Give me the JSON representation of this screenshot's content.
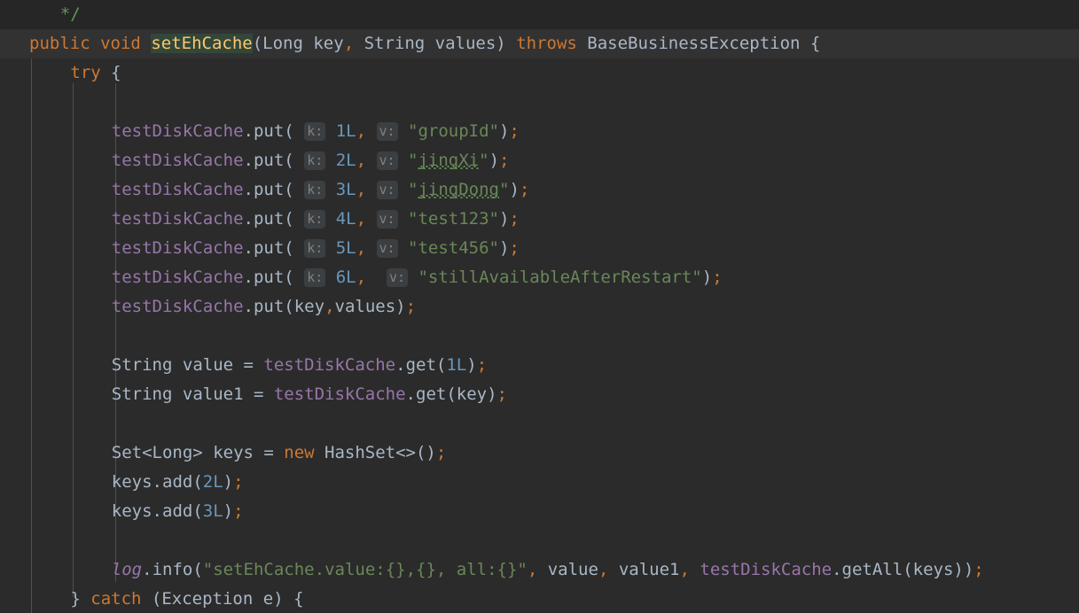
{
  "editor": {
    "language": "java",
    "theme": "darcula",
    "background": "#2b2b2b",
    "caret_line_background": "#323232",
    "colors": {
      "keyword": "#cc7832",
      "string": "#6a8759",
      "number": "#6897bb",
      "field": "#9876aa",
      "plain": "#a9b7c6",
      "comment": "#629755",
      "hint_text": "#808080",
      "hint_background": "#3c3f41",
      "identifier_highlight_background": "#32473a",
      "identifier_highlight_text": "#ffc66d",
      "indent_guide": "#4f5052",
      "typo_squiggle": "#629755"
    }
  },
  "code": {
    "lines": [
      {
        "id": "line-comment-end",
        "background": "dim",
        "indent": 3,
        "tokens": [
          {
            "cls": "cmt",
            "text": "*/"
          }
        ]
      },
      {
        "id": "line-method-signature",
        "background": "caret",
        "indent": 0,
        "tokens": [
          {
            "cls": "kw",
            "text": "public"
          },
          {
            "cls": "pln",
            "text": " "
          },
          {
            "cls": "kw",
            "text": "void"
          },
          {
            "cls": "pln",
            "text": " "
          },
          {
            "cls": "hl-ident",
            "text": "setEhCache"
          },
          {
            "cls": "pln",
            "text": "("
          },
          {
            "cls": "typ",
            "text": "Long"
          },
          {
            "cls": "pln",
            "text": " key"
          },
          {
            "cls": "semi",
            "text": ","
          },
          {
            "cls": "pln",
            "text": " "
          },
          {
            "cls": "typ",
            "text": "String"
          },
          {
            "cls": "pln",
            "text": " values) "
          },
          {
            "cls": "kw",
            "text": "throws"
          },
          {
            "cls": "pln",
            "text": " BaseBusinessException {"
          }
        ]
      },
      {
        "id": "line-try",
        "background": "none",
        "indent": 4,
        "tokens": [
          {
            "cls": "kw",
            "text": "try"
          },
          {
            "cls": "pln",
            "text": " {"
          }
        ]
      },
      {
        "id": "line-blank-1",
        "background": "none",
        "indent": 0,
        "tokens": []
      },
      {
        "id": "line-put-1",
        "background": "none",
        "indent": 8,
        "tokens": [
          {
            "cls": "fld",
            "text": "testDiskCache"
          },
          {
            "cls": "pln",
            "text": "."
          },
          {
            "cls": "mth",
            "text": "put"
          },
          {
            "cls": "pln",
            "text": "( "
          },
          {
            "cls": "hint",
            "text": "k:"
          },
          {
            "cls": "pln",
            "text": " "
          },
          {
            "cls": "num",
            "text": "1L"
          },
          {
            "cls": "semi",
            "text": ","
          },
          {
            "cls": "pln",
            "text": " "
          },
          {
            "cls": "hint",
            "text": "v:"
          },
          {
            "cls": "pln",
            "text": " "
          },
          {
            "cls": "str",
            "text": "\"groupId\""
          },
          {
            "cls": "pln",
            "text": ")"
          },
          {
            "cls": "semi",
            "text": ";"
          }
        ]
      },
      {
        "id": "line-put-2",
        "background": "none",
        "indent": 8,
        "tokens": [
          {
            "cls": "fld",
            "text": "testDiskCache"
          },
          {
            "cls": "pln",
            "text": "."
          },
          {
            "cls": "mth",
            "text": "put"
          },
          {
            "cls": "pln",
            "text": "( "
          },
          {
            "cls": "hint",
            "text": "k:"
          },
          {
            "cls": "pln",
            "text": " "
          },
          {
            "cls": "num",
            "text": "2L"
          },
          {
            "cls": "semi",
            "text": ","
          },
          {
            "cls": "pln",
            "text": " "
          },
          {
            "cls": "hint",
            "text": "v:"
          },
          {
            "cls": "pln",
            "text": " "
          },
          {
            "cls": "str",
            "text": "\""
          },
          {
            "cls": "str typo",
            "text": "jingXi"
          },
          {
            "cls": "str",
            "text": "\""
          },
          {
            "cls": "pln",
            "text": ")"
          },
          {
            "cls": "semi",
            "text": ";"
          }
        ]
      },
      {
        "id": "line-put-3",
        "background": "none",
        "indent": 8,
        "tokens": [
          {
            "cls": "fld",
            "text": "testDiskCache"
          },
          {
            "cls": "pln",
            "text": "."
          },
          {
            "cls": "mth",
            "text": "put"
          },
          {
            "cls": "pln",
            "text": "( "
          },
          {
            "cls": "hint",
            "text": "k:"
          },
          {
            "cls": "pln",
            "text": " "
          },
          {
            "cls": "num",
            "text": "3L"
          },
          {
            "cls": "semi",
            "text": ","
          },
          {
            "cls": "pln",
            "text": " "
          },
          {
            "cls": "hint",
            "text": "v:"
          },
          {
            "cls": "pln",
            "text": " "
          },
          {
            "cls": "str",
            "text": "\""
          },
          {
            "cls": "str typo",
            "text": "jingDong"
          },
          {
            "cls": "str",
            "text": "\""
          },
          {
            "cls": "pln",
            "text": ")"
          },
          {
            "cls": "semi",
            "text": ";"
          }
        ]
      },
      {
        "id": "line-put-4",
        "background": "none",
        "indent": 8,
        "tokens": [
          {
            "cls": "fld",
            "text": "testDiskCache"
          },
          {
            "cls": "pln",
            "text": "."
          },
          {
            "cls": "mth",
            "text": "put"
          },
          {
            "cls": "pln",
            "text": "( "
          },
          {
            "cls": "hint",
            "text": "k:"
          },
          {
            "cls": "pln",
            "text": " "
          },
          {
            "cls": "num",
            "text": "4L"
          },
          {
            "cls": "semi",
            "text": ","
          },
          {
            "cls": "pln",
            "text": " "
          },
          {
            "cls": "hint",
            "text": "v:"
          },
          {
            "cls": "pln",
            "text": " "
          },
          {
            "cls": "str",
            "text": "\"test123\""
          },
          {
            "cls": "pln",
            "text": ")"
          },
          {
            "cls": "semi",
            "text": ";"
          }
        ]
      },
      {
        "id": "line-put-5",
        "background": "none",
        "indent": 8,
        "tokens": [
          {
            "cls": "fld",
            "text": "testDiskCache"
          },
          {
            "cls": "pln",
            "text": "."
          },
          {
            "cls": "mth",
            "text": "put"
          },
          {
            "cls": "pln",
            "text": "( "
          },
          {
            "cls": "hint",
            "text": "k:"
          },
          {
            "cls": "pln",
            "text": " "
          },
          {
            "cls": "num",
            "text": "5L"
          },
          {
            "cls": "semi",
            "text": ","
          },
          {
            "cls": "pln",
            "text": " "
          },
          {
            "cls": "hint",
            "text": "v:"
          },
          {
            "cls": "pln",
            "text": " "
          },
          {
            "cls": "str",
            "text": "\"test456\""
          },
          {
            "cls": "pln",
            "text": ")"
          },
          {
            "cls": "semi",
            "text": ";"
          }
        ]
      },
      {
        "id": "line-put-6",
        "background": "none",
        "indent": 8,
        "tokens": [
          {
            "cls": "fld",
            "text": "testDiskCache"
          },
          {
            "cls": "pln",
            "text": "."
          },
          {
            "cls": "mth",
            "text": "put"
          },
          {
            "cls": "pln",
            "text": "( "
          },
          {
            "cls": "hint",
            "text": "k:"
          },
          {
            "cls": "pln",
            "text": " "
          },
          {
            "cls": "num",
            "text": "6L"
          },
          {
            "cls": "semi",
            "text": ","
          },
          {
            "cls": "pln",
            "text": "  "
          },
          {
            "cls": "hint",
            "text": "v:"
          },
          {
            "cls": "pln",
            "text": " "
          },
          {
            "cls": "str",
            "text": "\"stillAvailableAfterRestart\""
          },
          {
            "cls": "pln",
            "text": ")"
          },
          {
            "cls": "semi",
            "text": ";"
          }
        ]
      },
      {
        "id": "line-put-key-values",
        "background": "none",
        "indent": 8,
        "tokens": [
          {
            "cls": "fld",
            "text": "testDiskCache"
          },
          {
            "cls": "pln",
            "text": "."
          },
          {
            "cls": "mth",
            "text": "put"
          },
          {
            "cls": "pln",
            "text": "(key"
          },
          {
            "cls": "semi",
            "text": ","
          },
          {
            "cls": "pln",
            "text": "values)"
          },
          {
            "cls": "semi",
            "text": ";"
          }
        ]
      },
      {
        "id": "line-blank-2",
        "background": "none",
        "indent": 0,
        "tokens": []
      },
      {
        "id": "line-string-value",
        "background": "none",
        "indent": 8,
        "tokens": [
          {
            "cls": "typ",
            "text": "String"
          },
          {
            "cls": "pln",
            "text": " value = "
          },
          {
            "cls": "fld",
            "text": "testDiskCache"
          },
          {
            "cls": "pln",
            "text": "."
          },
          {
            "cls": "mth",
            "text": "get"
          },
          {
            "cls": "pln",
            "text": "("
          },
          {
            "cls": "num",
            "text": "1L"
          },
          {
            "cls": "pln",
            "text": ")"
          },
          {
            "cls": "semi",
            "text": ";"
          }
        ]
      },
      {
        "id": "line-string-value1",
        "background": "none",
        "indent": 8,
        "tokens": [
          {
            "cls": "typ",
            "text": "String"
          },
          {
            "cls": "pln",
            "text": " value1 = "
          },
          {
            "cls": "fld",
            "text": "testDiskCache"
          },
          {
            "cls": "pln",
            "text": "."
          },
          {
            "cls": "mth",
            "text": "get"
          },
          {
            "cls": "pln",
            "text": "(key)"
          },
          {
            "cls": "semi",
            "text": ";"
          }
        ]
      },
      {
        "id": "line-blank-3",
        "background": "none",
        "indent": 0,
        "tokens": []
      },
      {
        "id": "line-set-keys",
        "background": "none",
        "indent": 8,
        "tokens": [
          {
            "cls": "typ",
            "text": "Set<Long>"
          },
          {
            "cls": "pln",
            "text": " keys = "
          },
          {
            "cls": "kw",
            "text": "new"
          },
          {
            "cls": "pln",
            "text": " HashSet<>()"
          },
          {
            "cls": "semi",
            "text": ";"
          }
        ]
      },
      {
        "id": "line-keys-add-2",
        "background": "none",
        "indent": 8,
        "tokens": [
          {
            "cls": "pln",
            "text": "keys."
          },
          {
            "cls": "mth",
            "text": "add"
          },
          {
            "cls": "pln",
            "text": "("
          },
          {
            "cls": "num",
            "text": "2L"
          },
          {
            "cls": "pln",
            "text": ")"
          },
          {
            "cls": "semi",
            "text": ";"
          }
        ]
      },
      {
        "id": "line-keys-add-3",
        "background": "none",
        "indent": 8,
        "tokens": [
          {
            "cls": "pln",
            "text": "keys."
          },
          {
            "cls": "mth",
            "text": "add"
          },
          {
            "cls": "pln",
            "text": "("
          },
          {
            "cls": "num",
            "text": "3L"
          },
          {
            "cls": "pln",
            "text": ")"
          },
          {
            "cls": "semi",
            "text": ";"
          }
        ]
      },
      {
        "id": "line-blank-4",
        "background": "none",
        "indent": 0,
        "tokens": []
      },
      {
        "id": "line-log-info",
        "background": "none",
        "indent": 8,
        "tokens": [
          {
            "cls": "fldi",
            "text": "log"
          },
          {
            "cls": "pln",
            "text": "."
          },
          {
            "cls": "mth",
            "text": "info"
          },
          {
            "cls": "pln",
            "text": "("
          },
          {
            "cls": "str",
            "text": "\"setEhCache.value:{},{}, all:{}\""
          },
          {
            "cls": "semi",
            "text": ","
          },
          {
            "cls": "pln",
            "text": " value"
          },
          {
            "cls": "semi",
            "text": ","
          },
          {
            "cls": "pln",
            "text": " value1"
          },
          {
            "cls": "semi",
            "text": ","
          },
          {
            "cls": "pln",
            "text": " "
          },
          {
            "cls": "fld",
            "text": "testDiskCache"
          },
          {
            "cls": "pln",
            "text": "."
          },
          {
            "cls": "mth",
            "text": "getAll"
          },
          {
            "cls": "pln",
            "text": "(keys))"
          },
          {
            "cls": "semi",
            "text": ";"
          }
        ]
      },
      {
        "id": "line-catch",
        "background": "none",
        "indent": 4,
        "tokens": [
          {
            "cls": "pln",
            "text": "} "
          },
          {
            "cls": "kw",
            "text": "catch"
          },
          {
            "cls": "pln",
            "text": " (Exception e) {"
          }
        ]
      }
    ]
  }
}
